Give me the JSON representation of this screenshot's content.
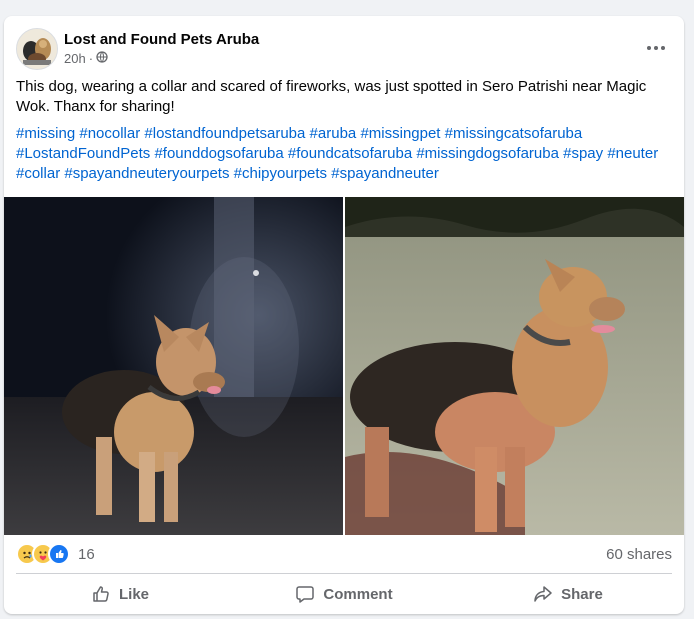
{
  "post": {
    "page_name": "Lost and Found Pets Aruba",
    "timestamp": "20h",
    "dot": "·",
    "audience_icon": "globe-icon",
    "more_icon": "more-dots-icon",
    "text": "This dog, wearing a collar and scared of fireworks, was just spotted in Sero Patrishi near Magic Wok. Thanx for sharing!",
    "hashtags": [
      "#missing",
      "#nocollar",
      "#lostandfoundpetsaruba",
      "#aruba",
      "#missingpet",
      "#missingcatsofaruba",
      "#LostandFoundPets",
      "#founddogsofaruba",
      "#foundcatsofaruba",
      "#missingdogsofaruba",
      "#spay",
      "#neuter",
      "#collar",
      "#spayandneuteryourpets",
      "#chipyourpets",
      "#spayandneuter"
    ],
    "hashtag_color": "#0064d1"
  },
  "engagement": {
    "reaction_icons": [
      "sad-reaction-icon",
      "care-reaction-icon",
      "like-reaction-icon"
    ],
    "reaction_count": "16",
    "shares": "60 shares"
  },
  "actions": {
    "like": "Like",
    "comment": "Comment",
    "share": "Share"
  }
}
